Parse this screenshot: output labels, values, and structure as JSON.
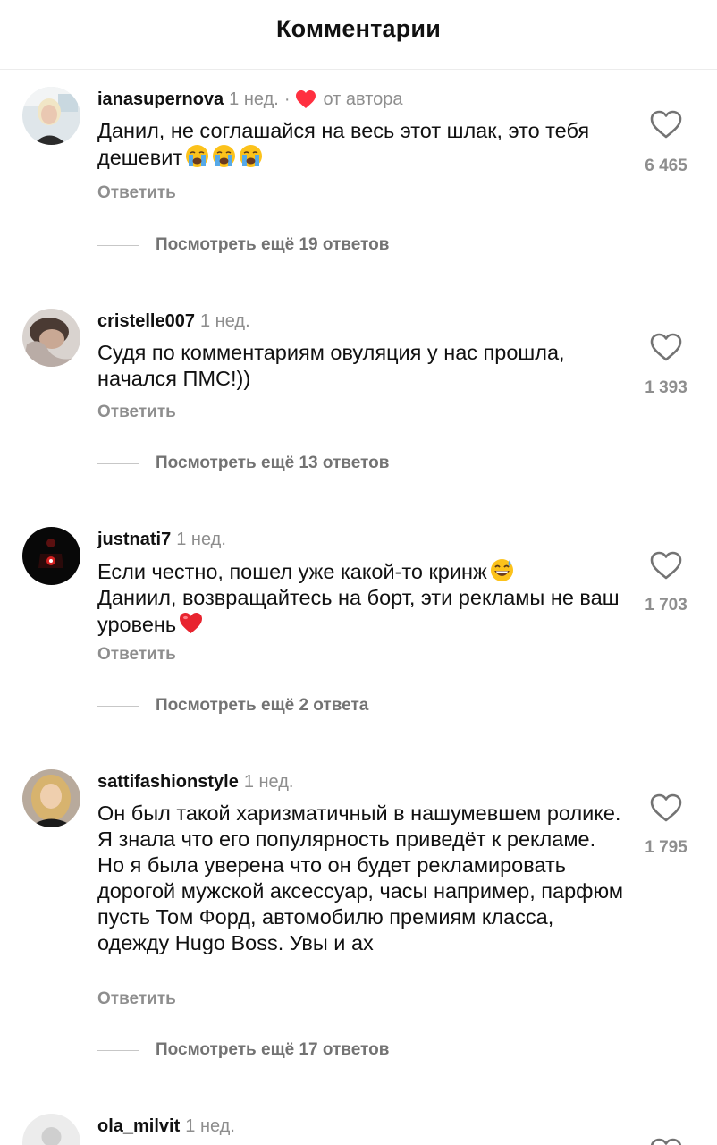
{
  "header": {
    "title": "Комментарии"
  },
  "comments": [
    {
      "username": "ianasupernova",
      "time": "1 нед.",
      "author_like_label": "от автора",
      "text": "Данил, не соглашайся на весь этот шлак, это тебя дешевит",
      "emoji": [
        "crying-face",
        "crying-face",
        "crying-face"
      ],
      "reply_label": "Ответить",
      "likes": "6 465",
      "more_replies": "Посмотреть ещё 19 ответов"
    },
    {
      "username": "cristelle007",
      "time": "1 нед.",
      "text": "Судя по комментариям овуляция у нас прошла, начался ПМС!))",
      "reply_label": "Ответить",
      "likes": "1 393",
      "more_replies": "Посмотреть ещё 13 ответов"
    },
    {
      "username": "justnati7",
      "time": "1 нед.",
      "text_line1": "Если честно, пошел уже какой-то кринж",
      "text_line2": "Даниил, возвращайтесь на борт, эти рекламы не ваш уровень",
      "emoji": [
        "grinning-sweat-face",
        "red-heart"
      ],
      "reply_label": "Ответить",
      "likes": "1 703",
      "more_replies": "Посмотреть ещё 2 ответа"
    },
    {
      "username": "sattifashionstyle",
      "time": "1 нед.",
      "text": "Он был такой харизматичный в нашумевшем ролике. Я знала что его популярность приведёт к рекламе. Но я была уверена что он будет рекламировать дорогой мужской аксессуар, часы например, парфюм пусть Том Форд, автомобилю премиям класса, одежду Hugo Boss. Увы и ах",
      "reply_label": "Ответить",
      "likes": "1 795",
      "more_replies": "Посмотреть ещё 17 ответов"
    },
    {
      "username": "ola_milvit",
      "time": "1 нед."
    }
  ],
  "icons": {
    "like": "heart-outline-icon",
    "author_like": "heart-filled-icon"
  },
  "colors": {
    "author_heart": "#ff3040",
    "muted_text": "#8e8e8e"
  }
}
